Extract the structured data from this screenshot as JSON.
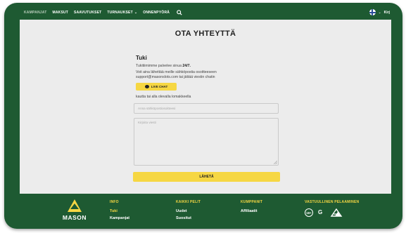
{
  "nav": {
    "items": [
      "KAMPANJAT",
      "MAKSUT",
      "SAAVUTUKSET",
      "TURNAUKSET",
      "ONNENPYÖRÄ"
    ],
    "language_label": "Kirj"
  },
  "page": {
    "title": "OTA YHTEYTTÄ",
    "section_title": "Tuki",
    "line1_prefix": "Tukitiimimme palvelee sinua",
    "line1_bold": "24/7.",
    "line2": "Voit aina lähettää meille sähköpostia osoitteeseen",
    "line3": "support@masonslots.com tai jättää viestin chatin",
    "live_chat_label": "LIVE CHAT",
    "form_hint": "kautta tai alla olevalla lomakkeella",
    "email_placeholder": "Anna sähköpostiosoitteesi",
    "message_placeholder": "Kirjoita viesti",
    "send_label": "LÄHETÄ"
  },
  "footer": {
    "logo_text": "MASON",
    "columns": [
      {
        "heading": "INFO",
        "links": [
          "Tuki",
          "Kampanjat"
        ]
      },
      {
        "heading": "KAIKKI PELIT",
        "links": [
          "Uudet",
          "Suositut"
        ]
      },
      {
        "heading": "KUMPPANIT",
        "links": [
          "Affiliaatit"
        ]
      },
      {
        "heading": "VASTUULLINEN PELAAMINEN",
        "links": []
      }
    ],
    "badge_18": "18+",
    "badge_gc": "G"
  },
  "colors": {
    "brand_green": "#1e5a32",
    "accent_yellow": "#f6d743",
    "background": "#ececec"
  }
}
